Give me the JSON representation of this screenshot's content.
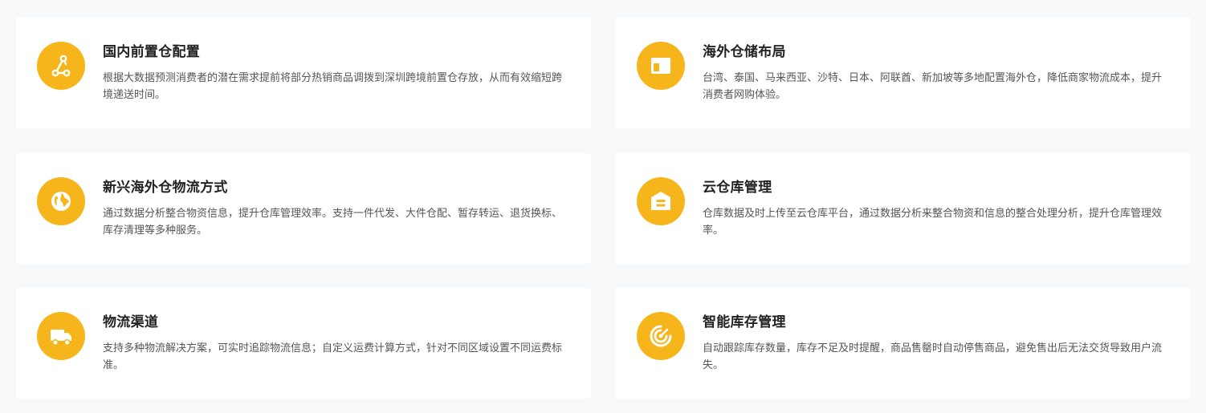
{
  "theme": {
    "background": "#f8f9fb",
    "card_background": "#ffffff",
    "accent": "#f6b61b",
    "title_color": "#222222",
    "text_color": "#555555"
  },
  "cards": [
    {
      "icon": "route-nodes-icon",
      "title": "国内前置仓配置",
      "description": "根据大数据预测消费者的潜在需求提前将部分热销商品调拨到深圳跨境前置仓存放，从而有效缩短跨境递送时间。"
    },
    {
      "icon": "window-layout-icon",
      "title": "海外仓储布局",
      "description": "台湾、泰国、马来西亚、沙特、日本、阿联酋、新加坡等多地配置海外仓，降低商家物流成本，提升消费者网购体验。"
    },
    {
      "icon": "globe-icon",
      "title": "新兴海外仓物流方式",
      "description": "通过数据分析整合物资信息，提升仓库管理效率。支持一件代发、大件仓配、暂存转运、退货换标、库存清理等多种服务。"
    },
    {
      "icon": "warehouse-icon",
      "title": "云仓库管理",
      "description": "仓库数据及时上传至云仓库平台，通过数据分析来整合物资和信息的整合处理分析，提升仓库管理效率。"
    },
    {
      "icon": "delivery-truck-icon",
      "title": "物流渠道",
      "description": "支持多种物流解决方案，可实时追踪物流信息；自定义运费计算方式，针对不同区域设置不同运费标准。"
    },
    {
      "icon": "radar-target-icon",
      "title": "智能库存管理",
      "description": "自动跟踪库存数量，库存不足及时提醒，商品售罄时自动停售商品，避免售出后无法交货导致用户流失。"
    }
  ]
}
